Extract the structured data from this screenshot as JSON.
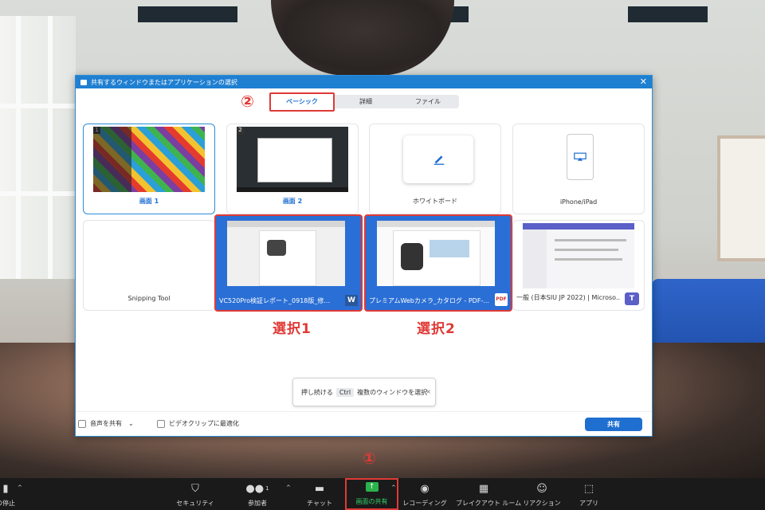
{
  "dialog": {
    "title": "共有するウィンドウまたはアプリケーションの選択",
    "close": "✕",
    "tabs": [
      {
        "label": "ベーシック",
        "active": true
      },
      {
        "label": "詳細",
        "active": false
      },
      {
        "label": "ファイル",
        "active": false
      }
    ],
    "tab_badge": "②",
    "cards": [
      {
        "label": "画面 1",
        "num": "1"
      },
      {
        "label": "画面 2",
        "num": "2"
      },
      {
        "label": "ホワイトボード"
      },
      {
        "label": "iPhone/iPad"
      },
      {
        "label": "Snipping Tool"
      },
      {
        "label": "VC520Pro検証レポート_0918版_修..."
      },
      {
        "label": "プレミアムWebカメラ_カタログ - PDF-..."
      },
      {
        "label": "一般 (日本SIU JP 2022) | Microso..."
      }
    ],
    "selection_captions": [
      "選択1",
      "選択2"
    ],
    "tooltip": {
      "prefix": "押し続ける",
      "key": "Ctrl",
      "suffix": "複数のウィンドウを選択",
      "close": "×"
    },
    "footer": {
      "share_audio": "音声を共有",
      "share_audio_caret": "⌄",
      "optimize_video": "ビデオクリップに最適化",
      "share_button": "共有"
    }
  },
  "toolbar": {
    "share_badge": "①",
    "items": [
      {
        "label": "の停止",
        "icon": "video-stop-icon"
      },
      {
        "label": "セキュリティ",
        "icon": "shield-icon"
      },
      {
        "label": "参加者",
        "icon": "participants-icon",
        "count": "1"
      },
      {
        "label": "チャット",
        "icon": "chat-icon"
      },
      {
        "label": "画面の共有",
        "icon": "share-screen-icon"
      },
      {
        "label": "レコーディング",
        "icon": "record-icon"
      },
      {
        "label": "ブレイクアウト ルーム",
        "icon": "breakout-icon"
      },
      {
        "label": "リアクション",
        "icon": "reaction-icon"
      },
      {
        "label": "アプリ",
        "icon": "apps-icon"
      }
    ],
    "caret": "^"
  },
  "colors": {
    "accent": "#1f6fd1",
    "highlight": "#e03a36",
    "share_green": "#2bb24c"
  }
}
